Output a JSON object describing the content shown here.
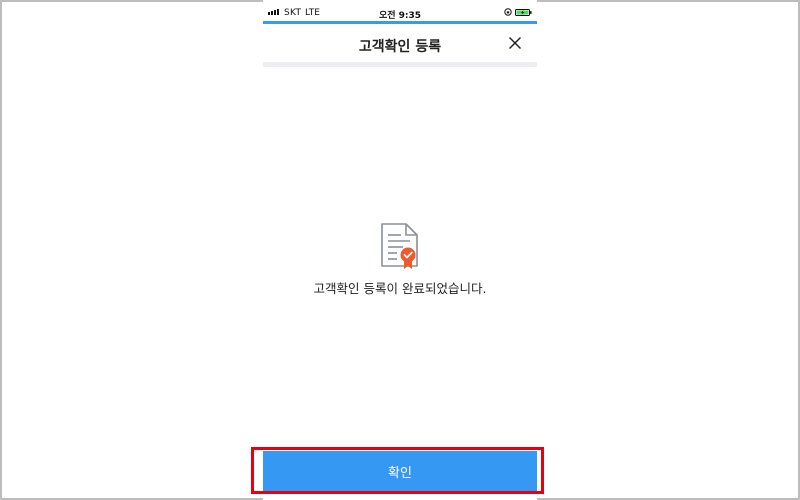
{
  "status_bar": {
    "carrier": "SKT",
    "network": "LTE",
    "time": "오전 9:35"
  },
  "header": {
    "title": "고객확인 등록"
  },
  "main": {
    "message": "고객확인 등록이 완료되었습니다."
  },
  "footer": {
    "confirm_label": "확인"
  },
  "icons": {
    "close": "close-icon",
    "document": "certificate-document-icon",
    "signal": "signal-icon",
    "lock": "orientation-lock-icon",
    "battery": "battery-charging-icon"
  },
  "colors": {
    "accent": "#3d9ae8",
    "button": "#3599f3",
    "badge": "#f0592b",
    "highlight": "#e8000f"
  }
}
